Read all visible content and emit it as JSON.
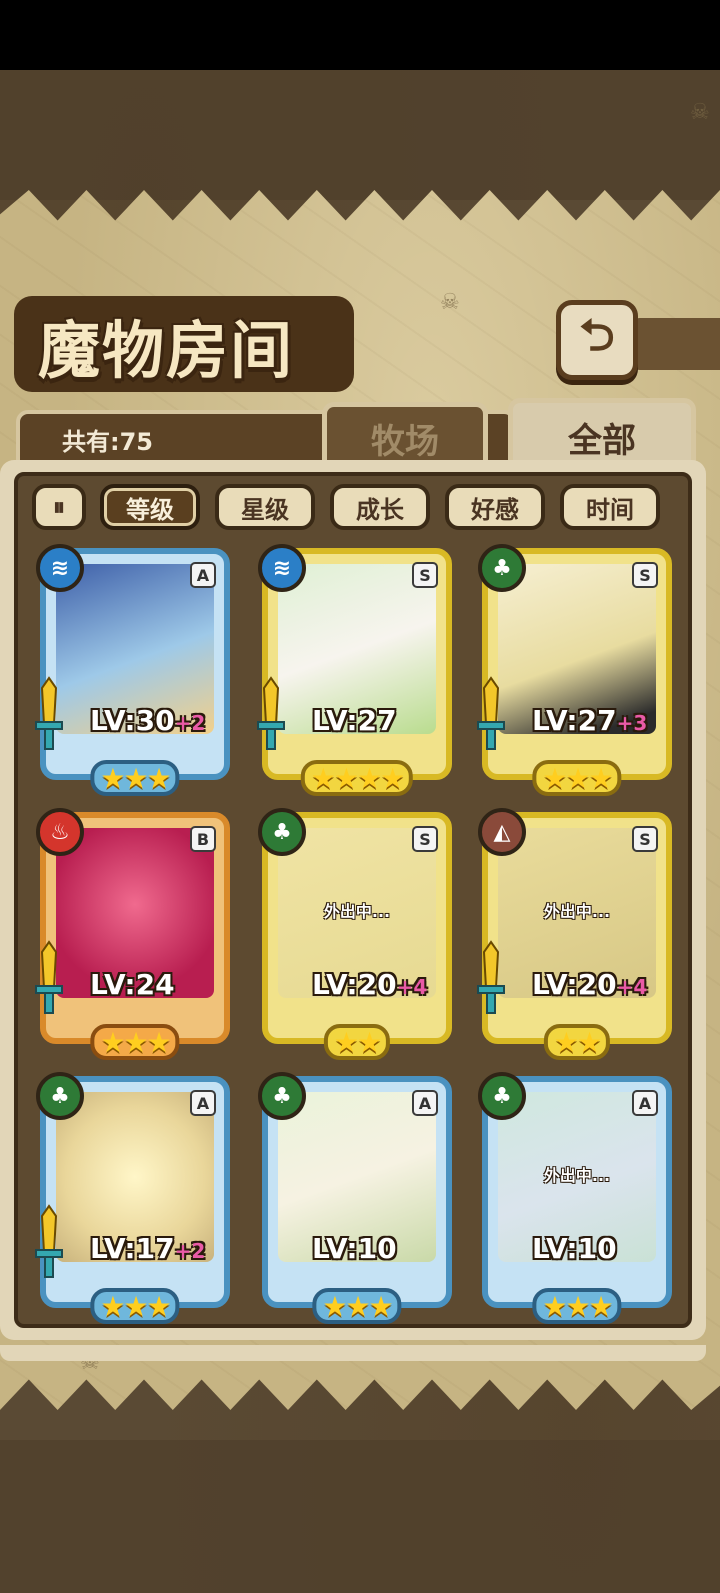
{
  "header": {
    "title": "魔物房间",
    "back_icon": "back-arrow-icon"
  },
  "summary": {
    "count_label": "共有:75"
  },
  "tabs": [
    {
      "label": "牧场",
      "active": false
    },
    {
      "label": "全部",
      "active": true
    }
  ],
  "sort": {
    "toggle_icon": "sort-order-icon",
    "buttons": [
      {
        "label": "等级",
        "active": true
      },
      {
        "label": "星级",
        "active": false
      },
      {
        "label": "成长",
        "active": false
      },
      {
        "label": "好感",
        "active": false
      },
      {
        "label": "时间",
        "active": false
      }
    ]
  },
  "monsters": [
    {
      "rank": "A",
      "element": "water",
      "level": "LV:30",
      "bonus": "+2",
      "stars": "★★★",
      "away": ""
    },
    {
      "rank": "S",
      "element": "water",
      "level": "LV:27",
      "bonus": "",
      "stars": "★★★★",
      "away": ""
    },
    {
      "rank": "S",
      "element": "grass",
      "level": "LV:27",
      "bonus": "+3",
      "stars": "★★★",
      "away": ""
    },
    {
      "rank": "B",
      "element": "fire",
      "level": "LV:24",
      "bonus": "",
      "stars": "★★★",
      "away": ""
    },
    {
      "rank": "S",
      "element": "grass",
      "level": "LV:20",
      "bonus": "+4",
      "stars": "★★",
      "away": "外出中..."
    },
    {
      "rank": "S",
      "element": "earth",
      "level": "LV:20",
      "bonus": "+4",
      "stars": "★★",
      "away": "外出中..."
    },
    {
      "rank": "A",
      "element": "grass",
      "level": "LV:17",
      "bonus": "+2",
      "stars": "★★★",
      "away": ""
    },
    {
      "rank": "A",
      "element": "grass",
      "level": "LV:10",
      "bonus": "",
      "stars": "★★★",
      "away": ""
    },
    {
      "rank": "A",
      "element": "grass",
      "level": "LV:10",
      "bonus": "",
      "stars": "★★★",
      "away": "外出中..."
    }
  ],
  "colors": {
    "frame_blue": "#4a92c0",
    "frame_gold": "#d8b924",
    "frame_orange": "#d98a2a",
    "bonus_pink": "#e95aa6",
    "star_yellow": "#ffce1f"
  }
}
